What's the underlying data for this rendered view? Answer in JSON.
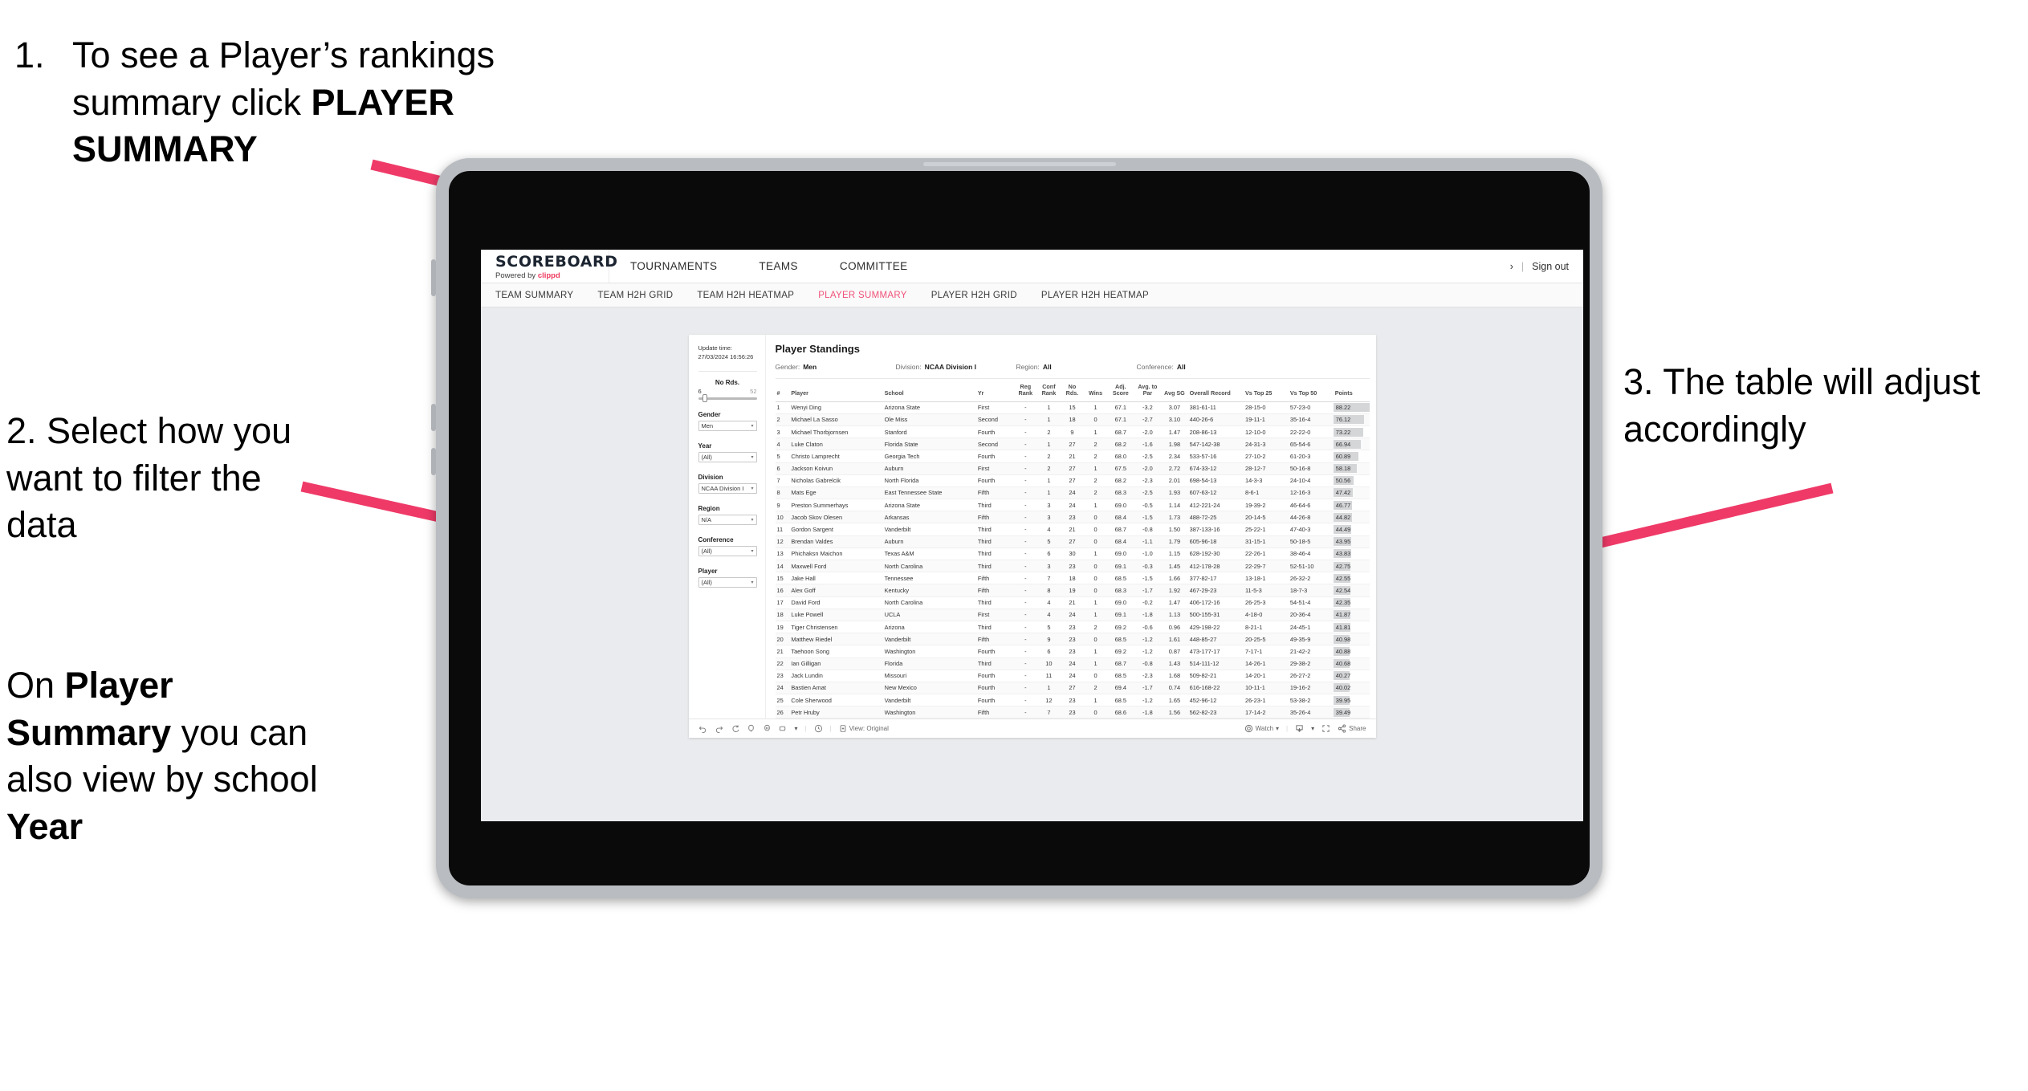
{
  "annotations": {
    "step1": {
      "number": "1.",
      "text_plain": "To see a Player’s rankings summary click ",
      "text_bold": "PLAYER SUMMARY"
    },
    "step2": "2. Select how you want to filter the data",
    "step2b_pre": "On ",
    "step2b_bold1": "Player Summary",
    "step2b_mid": " you can also view by school ",
    "step2b_bold2": "Year",
    "step3": "3. The table will adjust accordingly"
  },
  "accent_color": "#f0527a",
  "app": {
    "brand": {
      "title": "SCOREBOARD",
      "sub_prefix": "Powered by ",
      "sub_brand": "clippd"
    },
    "main_nav": [
      "TOURNAMENTS",
      "TEAMS",
      "COMMITTEE"
    ],
    "header_right": {
      "chevron": "›",
      "divider": "|",
      "sign_out": "Sign out"
    },
    "sub_tabs": [
      {
        "label": "TEAM SUMMARY",
        "active": false
      },
      {
        "label": "TEAM H2H GRID",
        "active": false
      },
      {
        "label": "TEAM H2H HEATMAP",
        "active": false
      },
      {
        "label": "PLAYER SUMMARY",
        "active": true
      },
      {
        "label": "PLAYER H2H GRID",
        "active": false
      },
      {
        "label": "PLAYER H2H HEATMAP",
        "active": false
      }
    ]
  },
  "filters": {
    "update_time_label": "Update time:",
    "update_time_value": "27/03/2024 16:56:26",
    "slider": {
      "label": "No Rds.",
      "min": "6",
      "max": "52",
      "value_pct": 8
    },
    "selects": [
      {
        "label": "Gender",
        "value": "Men"
      },
      {
        "label": "Year",
        "value": "(All)"
      },
      {
        "label": "Division",
        "value": "NCAA Division I"
      },
      {
        "label": "Region",
        "value": "N/A"
      },
      {
        "label": "Conference",
        "value": "(All)"
      },
      {
        "label": "Player",
        "value": "(All)"
      }
    ],
    "caret": "▾"
  },
  "table_panel": {
    "title": "Player Standings",
    "summary": [
      {
        "label": "Gender:",
        "value": "Men"
      },
      {
        "label": "Division:",
        "value": "NCAA Division I"
      },
      {
        "label": "Region:",
        "value": "All"
      },
      {
        "label": "Conference:",
        "value": "All"
      }
    ],
    "columns": [
      "#",
      "Player",
      "School",
      "Yr",
      "Reg Rank",
      "Conf Rank",
      "No Rds.",
      "Wins",
      "Adj. Score",
      "Avg. to Par",
      "Avg SG",
      "Overall Record",
      "Vs Top 25",
      "Vs Top 50",
      "Points"
    ],
    "rows": [
      [
        "1",
        "Wenyi Ding",
        "Arizona State",
        "First",
        "-",
        "1",
        "15",
        "1",
        "67.1",
        "-3.2",
        "3.07",
        "381-61-11",
        "28-15-0",
        "57-23-0",
        "88.22"
      ],
      [
        "2",
        "Michael La Sasso",
        "Ole Miss",
        "Second",
        "-",
        "1",
        "18",
        "0",
        "67.1",
        "-2.7",
        "3.10",
        "440-26-6",
        "19-11-1",
        "35-16-4",
        "76.12"
      ],
      [
        "3",
        "Michael Thorbjornsen",
        "Stanford",
        "Fourth",
        "-",
        "2",
        "9",
        "1",
        "68.7",
        "-2.0",
        "1.47",
        "208-86-13",
        "12-10-0",
        "22-22-0",
        "73.22"
      ],
      [
        "4",
        "Luke Claton",
        "Florida State",
        "Second",
        "-",
        "1",
        "27",
        "2",
        "68.2",
        "-1.6",
        "1.98",
        "547-142-38",
        "24-31-3",
        "65-54-6",
        "66.94"
      ],
      [
        "5",
        "Christo Lamprecht",
        "Georgia Tech",
        "Fourth",
        "-",
        "2",
        "21",
        "2",
        "68.0",
        "-2.5",
        "2.34",
        "533-57-16",
        "27-10-2",
        "61-20-3",
        "60.89"
      ],
      [
        "6",
        "Jackson Koivun",
        "Auburn",
        "First",
        "-",
        "2",
        "27",
        "1",
        "67.5",
        "-2.0",
        "2.72",
        "674-33-12",
        "28-12-7",
        "50-16-8",
        "58.18"
      ],
      [
        "7",
        "Nicholas Gabrelcik",
        "North Florida",
        "Fourth",
        "-",
        "1",
        "27",
        "2",
        "68.2",
        "-2.3",
        "2.01",
        "698-54-13",
        "14-3-3",
        "24-10-4",
        "50.56"
      ],
      [
        "8",
        "Mats Ege",
        "East Tennessee State",
        "Fifth",
        "-",
        "1",
        "24",
        "2",
        "68.3",
        "-2.5",
        "1.93",
        "607-63-12",
        "8-6-1",
        "12-16-3",
        "47.42"
      ],
      [
        "9",
        "Preston Summerhays",
        "Arizona State",
        "Third",
        "-",
        "3",
        "24",
        "1",
        "69.0",
        "-0.5",
        "1.14",
        "412-221-24",
        "19-39-2",
        "46-64-6",
        "46.77"
      ],
      [
        "10",
        "Jacob Skov Olesen",
        "Arkansas",
        "Fifth",
        "-",
        "3",
        "23",
        "0",
        "68.4",
        "-1.5",
        "1.73",
        "488-72-25",
        "20-14-5",
        "44-26-8",
        "44.82"
      ],
      [
        "11",
        "Gordon Sargent",
        "Vanderbilt",
        "Third",
        "-",
        "4",
        "21",
        "0",
        "68.7",
        "-0.8",
        "1.50",
        "387-133-16",
        "25-22-1",
        "47-40-3",
        "44.49"
      ],
      [
        "12",
        "Brendan Valdes",
        "Auburn",
        "Third",
        "-",
        "5",
        "27",
        "0",
        "68.4",
        "-1.1",
        "1.79",
        "605-96-18",
        "31-15-1",
        "50-18-5",
        "43.95"
      ],
      [
        "13",
        "Phichaksn Maichon",
        "Texas A&M",
        "Third",
        "-",
        "6",
        "30",
        "1",
        "69.0",
        "-1.0",
        "1.15",
        "628-192-30",
        "22-26-1",
        "38-46-4",
        "43.83"
      ],
      [
        "14",
        "Maxwell Ford",
        "North Carolina",
        "Third",
        "-",
        "3",
        "23",
        "0",
        "69.1",
        "-0.3",
        "1.45",
        "412-178-28",
        "22-29-7",
        "52-51-10",
        "42.75"
      ],
      [
        "15",
        "Jake Hall",
        "Tennessee",
        "Fifth",
        "-",
        "7",
        "18",
        "0",
        "68.5",
        "-1.5",
        "1.66",
        "377-82-17",
        "13-18-1",
        "26-32-2",
        "42.55"
      ],
      [
        "16",
        "Alex Goff",
        "Kentucky",
        "Fifth",
        "-",
        "8",
        "19",
        "0",
        "68.3",
        "-1.7",
        "1.92",
        "467-29-23",
        "11-5-3",
        "18-7-3",
        "42.54"
      ],
      [
        "17",
        "David Ford",
        "North Carolina",
        "Third",
        "-",
        "4",
        "21",
        "1",
        "69.0",
        "-0.2",
        "1.47",
        "406-172-16",
        "26-25-3",
        "54-51-4",
        "42.35"
      ],
      [
        "18",
        "Luke Powell",
        "UCLA",
        "First",
        "-",
        "4",
        "24",
        "1",
        "69.1",
        "-1.8",
        "1.13",
        "500-155-31",
        "4-18-0",
        "20-36-4",
        "41.87"
      ],
      [
        "19",
        "Tiger Christensen",
        "Arizona",
        "Third",
        "-",
        "5",
        "23",
        "2",
        "69.2",
        "-0.6",
        "0.96",
        "429-198-22",
        "8-21-1",
        "24-45-1",
        "41.81"
      ],
      [
        "20",
        "Matthew Riedel",
        "Vanderbilt",
        "Fifth",
        "-",
        "9",
        "23",
        "0",
        "68.5",
        "-1.2",
        "1.61",
        "448-85-27",
        "20-25-5",
        "49-35-9",
        "40.98"
      ],
      [
        "21",
        "Taehoon Song",
        "Washington",
        "Fourth",
        "-",
        "6",
        "23",
        "1",
        "69.2",
        "-1.2",
        "0.87",
        "473-177-17",
        "7-17-1",
        "21-42-2",
        "40.88"
      ],
      [
        "22",
        "Ian Gilligan",
        "Florida",
        "Third",
        "-",
        "10",
        "24",
        "1",
        "68.7",
        "-0.8",
        "1.43",
        "514-111-12",
        "14-26-1",
        "29-38-2",
        "40.68"
      ],
      [
        "23",
        "Jack Lundin",
        "Missouri",
        "Fourth",
        "-",
        "11",
        "24",
        "0",
        "68.5",
        "-2.3",
        "1.68",
        "509-82-21",
        "14-20-1",
        "26-27-2",
        "40.27"
      ],
      [
        "24",
        "Bastien Amat",
        "New Mexico",
        "Fourth",
        "-",
        "1",
        "27",
        "2",
        "69.4",
        "-1.7",
        "0.74",
        "616-168-22",
        "10-11-1",
        "19-16-2",
        "40.02"
      ],
      [
        "25",
        "Cole Sherwood",
        "Vanderbilt",
        "Fourth",
        "-",
        "12",
        "23",
        "1",
        "68.5",
        "-1.2",
        "1.65",
        "452-96-12",
        "26-23-1",
        "53-38-2",
        "39.95"
      ],
      [
        "26",
        "Petr Hruby",
        "Washington",
        "Fifth",
        "-",
        "7",
        "23",
        "0",
        "68.6",
        "-1.8",
        "1.56",
        "562-82-23",
        "17-14-2",
        "35-26-4",
        "39.49"
      ]
    ]
  },
  "toolbar": {
    "view_label": "View: Original",
    "watch_label": "Watch",
    "share_label": "Share",
    "caret": "▾",
    "separator": "|"
  }
}
